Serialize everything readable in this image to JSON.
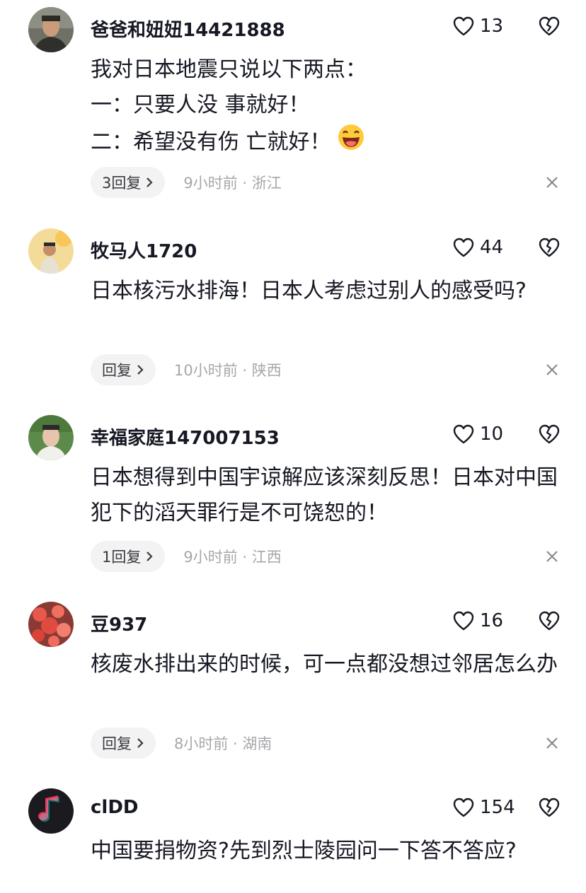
{
  "comments": [
    {
      "username": "爸爸和妞妞14421888",
      "likes": "13",
      "text": "我对日本地震只说以下两点：\n一：只要人没 事就好！\n二：希望没有伤 亡就好！",
      "reply": "3回复",
      "time": "9小时前",
      "location": "浙江",
      "emoji": "laughing-emoji"
    },
    {
      "username": "牧马人1720",
      "likes": "44",
      "text": "日本核污水排海！日本人考虑过别人的感受吗?",
      "reply": "回复",
      "time": "10小时前",
      "location": "陕西"
    },
    {
      "username": "幸福家庭147007153",
      "likes": "10",
      "text": "日本想得到中国宇谅解应该深刻反思！日本对中国犯下的滔天罪行是不可饶恕的！",
      "reply": "1回复",
      "time": "9小时前",
      "location": "江西"
    },
    {
      "username": "豆937",
      "likes": "16",
      "text": "核废水排出来的时候，可一点都没想过邻居怎么办",
      "reply": "回复",
      "time": "8小时前",
      "location": "湖南"
    },
    {
      "username": "clDD",
      "likes": "154",
      "text": "中国要捐物资?先到烈士陵园问一下答不答应?"
    }
  ],
  "separator": " · ",
  "icons": {
    "like": "heart-outline-icon",
    "dislike": "broken-heart-icon",
    "reply_arrow": "chevron-right-icon",
    "close": "close-icon"
  },
  "colors": {
    "text_primary": "#161823",
    "text_secondary": "#a6a7ab",
    "reply_bg": "#f3f3f4"
  }
}
